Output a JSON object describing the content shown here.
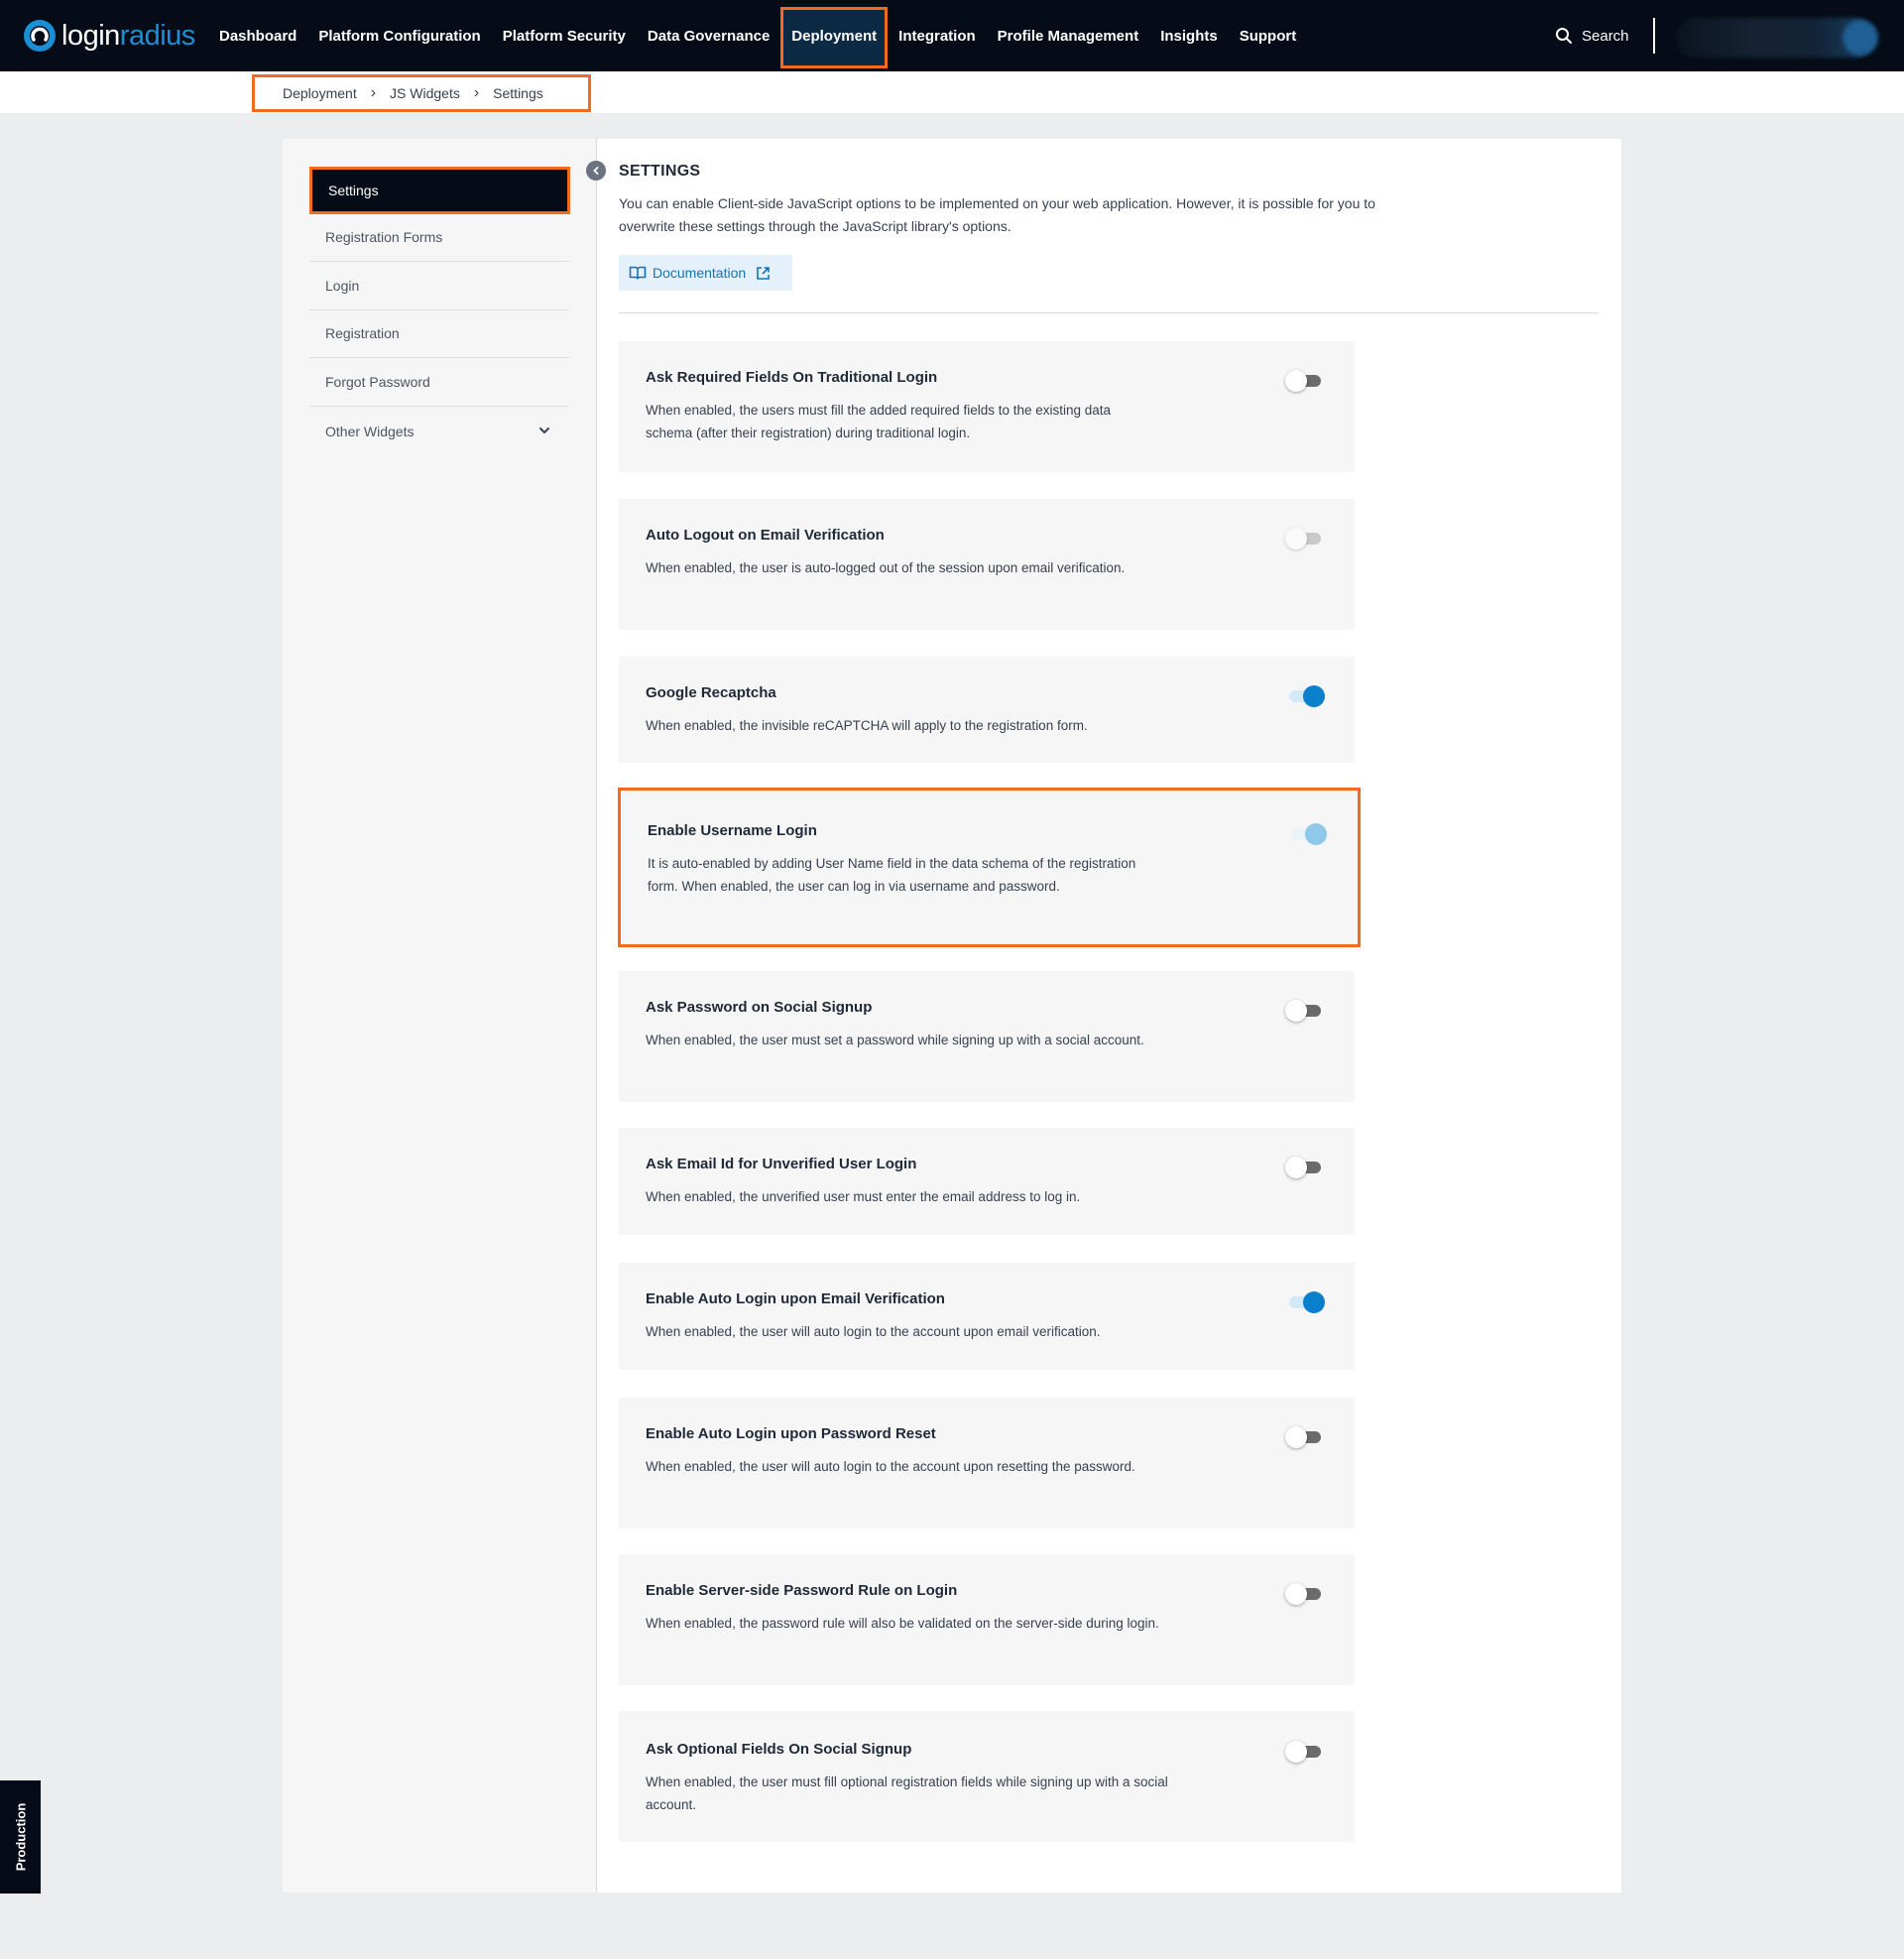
{
  "brand": {
    "logo_part1": "login",
    "logo_part2": "radius",
    "accent": "#f26b21",
    "primary": "#0a7fcb"
  },
  "nav": {
    "items": [
      {
        "label": "Dashboard",
        "active": false
      },
      {
        "label": "Platform Configuration",
        "active": false
      },
      {
        "label": "Platform Security",
        "active": false
      },
      {
        "label": "Data Governance",
        "active": false
      },
      {
        "label": "Deployment",
        "active": true
      },
      {
        "label": "Integration",
        "active": false
      },
      {
        "label": "Profile Management",
        "active": false
      },
      {
        "label": "Insights",
        "active": false
      },
      {
        "label": "Support",
        "active": false
      }
    ],
    "search_label": "Search",
    "search_icon": "search-icon"
  },
  "breadcrumb": [
    "Deployment",
    "JS Widgets",
    "Settings"
  ],
  "sidebar": {
    "items": [
      {
        "label": "Settings",
        "active": true
      },
      {
        "label": "Registration Forms",
        "active": false
      },
      {
        "label": "Login",
        "active": false
      },
      {
        "label": "Registration",
        "active": false
      },
      {
        "label": "Forgot Password",
        "active": false
      },
      {
        "label": "Other Widgets",
        "active": false,
        "expandable": true
      }
    ]
  },
  "main": {
    "title": "SETTINGS",
    "description": "You can enable Client-side JavaScript options to be implemented on your web application. However, it is possible for you to overwrite these settings through the JavaScript library's options.",
    "doc_button": "Documentation",
    "settings": [
      {
        "title": "Ask Required Fields On Traditional Login",
        "desc": "When enabled, the users must fill the added required fields to the existing data schema (after their registration) during traditional login.",
        "state": "off"
      },
      {
        "title": "Auto Logout on Email Verification",
        "desc": "When enabled, the user is auto-logged out of the session upon email verification.",
        "state": "disabled"
      },
      {
        "title": "Google Recaptcha",
        "desc": "When enabled, the invisible reCAPTCHA will apply to the registration form.",
        "state": "on"
      },
      {
        "title": "Enable Username Login",
        "desc": "It is auto-enabled by adding User Name field in the data schema of the registration form. When enabled, the user can log in via username and password.",
        "state": "on-disabled"
      },
      {
        "title": "Ask Password on Social Signup",
        "desc": "When enabled, the user must set a password while signing up with a social account.",
        "state": "off"
      },
      {
        "title": "Ask Email Id for Unverified User Login",
        "desc": "When enabled, the unverified user must enter the email address to log in.",
        "state": "off"
      },
      {
        "title": "Enable Auto Login upon Email Verification",
        "desc": "When enabled, the user will auto login to the account upon email verification.",
        "state": "on"
      },
      {
        "title": "Enable Auto Login upon Password Reset",
        "desc": "When enabled, the user will auto login to the account upon resetting the password.",
        "state": "off"
      },
      {
        "title": "Enable Server-side Password Rule on Login",
        "desc": "When enabled, the password rule will also be validated on the server-side during login.",
        "state": "off"
      },
      {
        "title": "Ask Optional Fields On Social Signup",
        "desc": "When enabled, the user must fill optional registration fields while signing up with a social account.",
        "state": "off"
      }
    ]
  },
  "environment_tab": "Production"
}
